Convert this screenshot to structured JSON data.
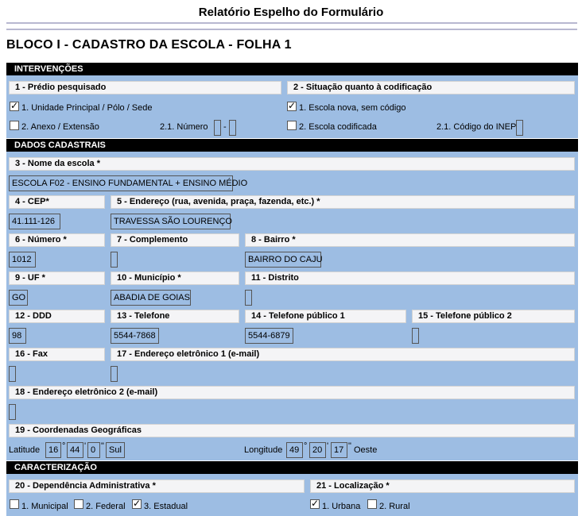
{
  "report_title": "Relatório Espelho do Formulário",
  "bloco_title": "BLOCO I - CADASTRO DA ESCOLA - FOLHA 1",
  "sections": {
    "intervencoes": "INTERVENÇÕES",
    "dados_cadastrais": "DADOS CADASTRAIS",
    "caracterizacao": "CARACTERIZAÇÃO"
  },
  "intervencoes": {
    "q1_label": "1 - Prédio pesquisado",
    "q1_opt1": "1. Unidade Principal / Pólo / Sede",
    "q1_opt1_checked": true,
    "q1_opt2": "2. Anexo / Extensão",
    "q1_opt2_checked": false,
    "q1_numero_label": "2.1. Número",
    "q1_numero_sep": "-",
    "q2_label": "2 - Situação quanto à codificação",
    "q2_opt1": "1. Escola nova, sem código",
    "q2_opt1_checked": true,
    "q2_opt2": "2. Escola codificada",
    "q2_opt2_checked": false,
    "q2_inep_label": "2.1. Código do INEP"
  },
  "dados": {
    "nome_label": "3 - Nome da escola *",
    "nome_value": "ESCOLA F02 - ENSINO FUNDAMENTAL + ENSINO MÉDIO",
    "cep_label": "4 - CEP*",
    "cep_value": "41.111-126",
    "endereco_label": "5 - Endereço (rua, avenida, praça, fazenda, etc.) *",
    "endereco_value": "TRAVESSA SÃO LOURENÇO",
    "numero_label": "6 - Número *",
    "numero_value": "1012",
    "complemento_label": "7 - Complemento",
    "complemento_value": "",
    "bairro_label": "8 - Bairro *",
    "bairro_value": "BAIRRO DO CAJU",
    "uf_label": "9 - UF *",
    "uf_value": "GO",
    "municipio_label": "10 - Município *",
    "municipio_value": "ABADIA DE GOIAS",
    "distrito_label": "11 - Distrito",
    "distrito_value": "",
    "ddd_label": "12 - DDD",
    "ddd_value": "98",
    "telefone_label": "13 - Telefone",
    "telefone_value": "5544-7868",
    "tel_pub1_label": "14 - Telefone público 1",
    "tel_pub1_value": "5544-6879",
    "tel_pub2_label": "15 - Telefone público 2",
    "tel_pub2_value": "",
    "fax_label": "16 - Fax",
    "fax_value": "",
    "email1_label": "17 - Endereço eletrônico 1 (e-mail)",
    "email1_value": "",
    "email2_label": "18 - Endereço eletrônico 2 (e-mail)",
    "email2_value": "",
    "coord_label": "19 - Coordenadas Geográficas",
    "lat_label": "Latitude",
    "lat_deg": "16",
    "lat_min": "44",
    "lat_sec": "0",
    "lat_hem": "Sul",
    "lon_label": "Longitude",
    "lon_deg": "49",
    "lon_min": "20",
    "lon_sec": "17",
    "lon_hem": "Oeste",
    "deg_sym": "°",
    "min_sym": "'",
    "sec_sym": "\""
  },
  "caracterizacao": {
    "dep_label": "20 - Dependência Administrativa *",
    "dep_opt1": "1. Municipal",
    "dep_opt1_checked": false,
    "dep_opt2": "2. Federal",
    "dep_opt2_checked": false,
    "dep_opt3": "3. Estadual",
    "dep_opt3_checked": true,
    "loc_label": "21 - Localização *",
    "loc_opt1": "1. Urbana",
    "loc_opt1_checked": true,
    "loc_opt2": "2. Rural",
    "loc_opt2_checked": false
  }
}
